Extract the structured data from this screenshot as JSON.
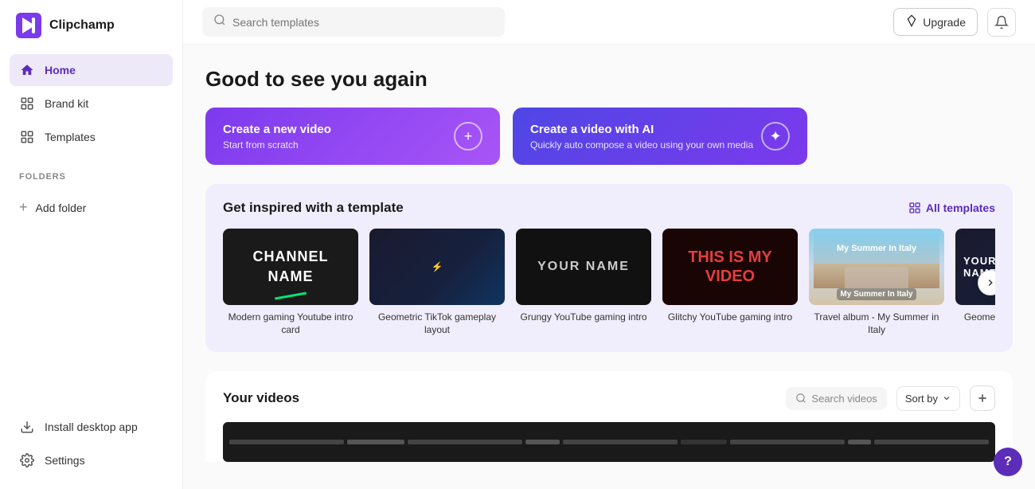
{
  "app": {
    "name": "Clipchamp"
  },
  "topbar": {
    "search_placeholder": "Search templates",
    "upgrade_label": "Upgrade",
    "notification_icon": "bell"
  },
  "sidebar": {
    "nav_items": [
      {
        "id": "home",
        "label": "Home",
        "icon": "home",
        "active": true
      },
      {
        "id": "brand-kit",
        "label": "Brand kit",
        "icon": "tag"
      },
      {
        "id": "templates",
        "label": "Templates",
        "icon": "grid"
      }
    ],
    "folders_label": "FOLDERS",
    "add_folder_label": "Add folder",
    "bottom_items": [
      {
        "id": "install",
        "label": "Install desktop app",
        "icon": "download"
      },
      {
        "id": "settings",
        "label": "Settings",
        "icon": "gear"
      }
    ]
  },
  "hero": {
    "title": "Good to see you again"
  },
  "cta": {
    "new_video": {
      "title": "Create a new video",
      "subtitle": "Start from scratch",
      "icon": "plus"
    },
    "ai_video": {
      "title": "Create a video with AI",
      "subtitle": "Quickly auto compose a video using your own media",
      "icon": "sparkle"
    }
  },
  "templates_section": {
    "title": "Get inspired with a template",
    "all_templates_label": "All templates",
    "cards": [
      {
        "id": "t1",
        "label": "Modern gaming Youtube intro card"
      },
      {
        "id": "t2",
        "label": "Geometric TikTok gameplay layout"
      },
      {
        "id": "t3",
        "label": "Grungy YouTube gaming intro"
      },
      {
        "id": "t4",
        "label": "Glitchy YouTube gaming intro"
      },
      {
        "id": "t5",
        "label": "Travel album - My Summer in Italy"
      },
      {
        "id": "t6",
        "label": "Geometric YouTube gaming intro"
      }
    ]
  },
  "videos_section": {
    "title": "Your videos",
    "search_placeholder": "Search videos",
    "sort_label": "Sort by",
    "add_icon": "plus"
  },
  "help": {
    "label": "?"
  }
}
